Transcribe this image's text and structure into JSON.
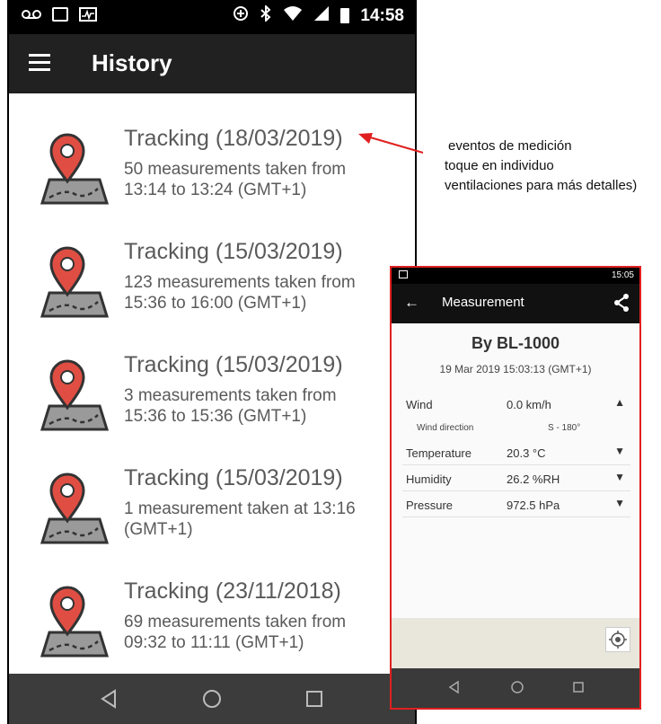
{
  "status_bar": {
    "time": "14:58"
  },
  "app_bar": {
    "title": "History"
  },
  "history": [
    {
      "title": "Tracking (18/03/2019)",
      "line1": "50 measurements taken from",
      "line2": "13:14 to 13:24 (GMT+1)"
    },
    {
      "title": "Tracking (15/03/2019)",
      "line1": "123 measurements taken from",
      "line2": "15:36 to 16:00 (GMT+1)"
    },
    {
      "title": "Tracking (15/03/2019)",
      "line1": "3 measurements taken from",
      "line2": "15:36 to 15:36 (GMT+1)"
    },
    {
      "title": "Tracking (15/03/2019)",
      "line1": "1 measurement taken at 13:16",
      "line2": "(GMT+1)"
    },
    {
      "title": "Tracking (23/11/2018)",
      "line1": "69 measurements taken from",
      "line2": "09:32 to 11:11 (GMT+1)"
    }
  ],
  "annotation": {
    "line1": "eventos de medición",
    "line2": "toque en individuo",
    "line3": "ventilaciones para más detalles)"
  },
  "detail": {
    "status_time": "15:05",
    "title": "Measurement",
    "device": "By BL-1000",
    "datetime": "19 Mar 2019 15:03:13 (GMT+1)",
    "wind": {
      "label": "Wind",
      "value": "0.0 km/h"
    },
    "wind_direction": {
      "label": "Wind direction",
      "value": "S - 180°"
    },
    "temperature": {
      "label": "Temperature",
      "value": "20.3 °C"
    },
    "humidity": {
      "label": "Humidity",
      "value": "26.2 %RH"
    },
    "pressure": {
      "label": "Pressure",
      "value": "972.5 hPa"
    }
  },
  "colors": {
    "accent_red": "#e04e43",
    "frame_red": "#e02020",
    "app_bar": "#212121",
    "nav_bar": "#3c3c3c"
  },
  "icons": [
    "voicemail-icon",
    "image-icon",
    "activity-icon",
    "data-saver-icon",
    "bluetooth-icon",
    "wifi-icon",
    "signal-icon",
    "battery-icon",
    "menu-icon",
    "map-pin-icon",
    "back-icon",
    "share-icon",
    "chevron-up-icon",
    "chevron-down-icon",
    "locate-icon"
  ]
}
